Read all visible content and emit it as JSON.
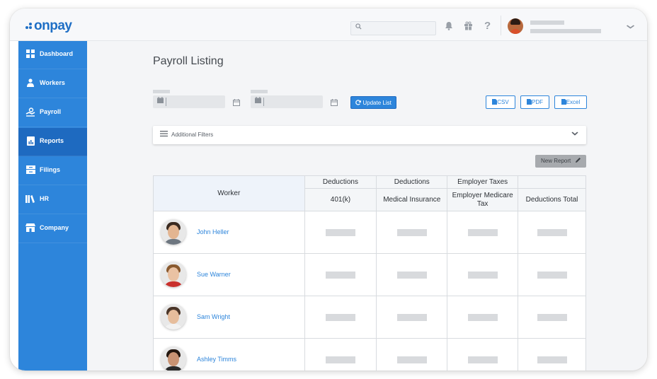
{
  "app": {
    "logo_text": "onpay",
    "brand_color": "#2d85db"
  },
  "topbar": {
    "search": {
      "icon": "search-icon",
      "placeholder": ""
    },
    "icons": [
      "bell-icon",
      "gift-icon",
      "help-icon"
    ],
    "help_glyph": "?",
    "user": {
      "avatar": "user-avatar"
    }
  },
  "sidebar": {
    "items": [
      {
        "label": "Dashboard",
        "icon": "dashboard-icon",
        "active": false
      },
      {
        "label": "Workers",
        "icon": "workers-icon",
        "active": false
      },
      {
        "label": "Payroll",
        "icon": "payroll-icon",
        "active": false
      },
      {
        "label": "Reports",
        "icon": "reports-icon",
        "active": true
      },
      {
        "label": "Filings",
        "icon": "filings-icon",
        "active": false
      },
      {
        "label": "HR",
        "icon": "hr-icon",
        "active": false
      },
      {
        "label": "Company",
        "icon": "company-icon",
        "active": false
      }
    ]
  },
  "main": {
    "title": "Payroll Listing",
    "update_button": "Update List",
    "export_buttons": [
      "CSV",
      "PDF",
      "Excel"
    ],
    "filters_label": "Additional Filters",
    "new_report_button": "New Report"
  },
  "table": {
    "worker_header": "Worker",
    "groups": [
      "Deductions",
      "Deductions",
      "Employer Taxes",
      ""
    ],
    "columns": [
      "401(k)",
      "Medical Insurance",
      "Employer Medicare Tax",
      "Deductions Total"
    ],
    "rows": [
      {
        "name": "John Heller"
      },
      {
        "name": "Sue Warner"
      },
      {
        "name": "Sam Wright"
      },
      {
        "name": "Ashley Timms"
      }
    ]
  }
}
